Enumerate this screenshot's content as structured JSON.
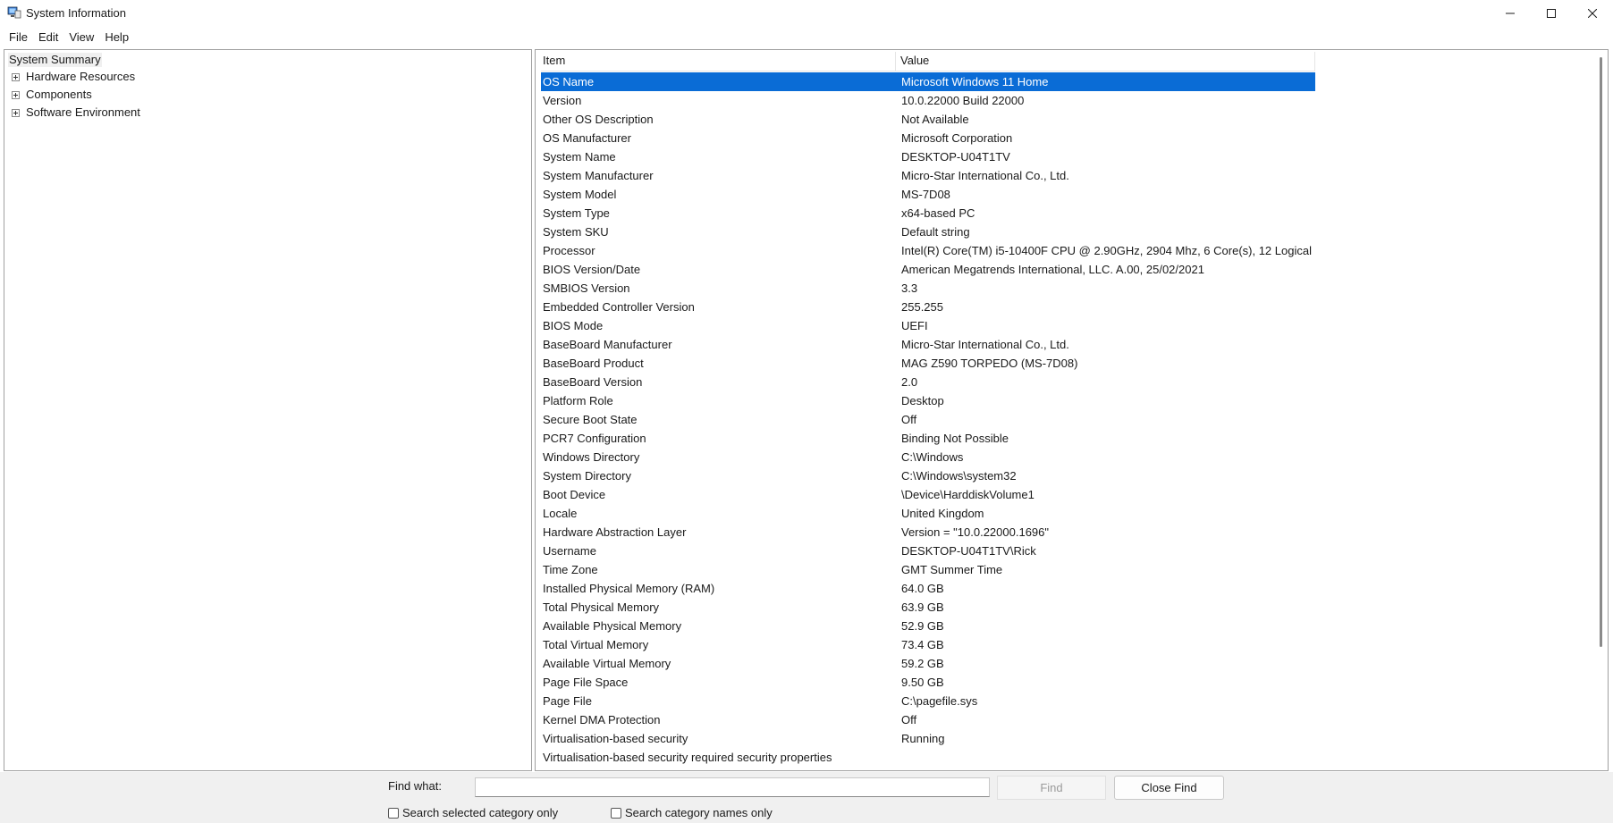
{
  "window": {
    "title": "System Information"
  },
  "menu": [
    "File",
    "Edit",
    "View",
    "Help"
  ],
  "tree": {
    "root": "System Summary",
    "children": [
      "Hardware Resources",
      "Components",
      "Software Environment"
    ]
  },
  "table": {
    "headers": {
      "item": "Item",
      "value": "Value"
    },
    "rows": [
      {
        "item": "OS Name",
        "value": "Microsoft Windows 11 Home",
        "selected": true
      },
      {
        "item": "Version",
        "value": "10.0.22000 Build 22000"
      },
      {
        "item": "Other OS Description",
        "value": "Not Available"
      },
      {
        "item": "OS Manufacturer",
        "value": "Microsoft Corporation"
      },
      {
        "item": "System Name",
        "value": "DESKTOP-U04T1TV"
      },
      {
        "item": "System Manufacturer",
        "value": "Micro-Star International Co., Ltd."
      },
      {
        "item": "System Model",
        "value": "MS-7D08"
      },
      {
        "item": "System Type",
        "value": "x64-based PC"
      },
      {
        "item": "System SKU",
        "value": "Default string"
      },
      {
        "item": "Processor",
        "value": "Intel(R) Core(TM) i5-10400F CPU @ 2.90GHz, 2904 Mhz, 6 Core(s), 12 Logical ..."
      },
      {
        "item": "BIOS Version/Date",
        "value": "American Megatrends International, LLC. A.00, 25/02/2021"
      },
      {
        "item": "SMBIOS Version",
        "value": "3.3"
      },
      {
        "item": "Embedded Controller Version",
        "value": "255.255"
      },
      {
        "item": "BIOS Mode",
        "value": "UEFI"
      },
      {
        "item": "BaseBoard Manufacturer",
        "value": "Micro-Star International Co., Ltd."
      },
      {
        "item": "BaseBoard Product",
        "value": "MAG Z590 TORPEDO (MS-7D08)"
      },
      {
        "item": "BaseBoard Version",
        "value": "2.0"
      },
      {
        "item": "Platform Role",
        "value": "Desktop"
      },
      {
        "item": "Secure Boot State",
        "value": "Off"
      },
      {
        "item": "PCR7 Configuration",
        "value": "Binding Not Possible"
      },
      {
        "item": "Windows Directory",
        "value": "C:\\Windows"
      },
      {
        "item": "System Directory",
        "value": "C:\\Windows\\system32"
      },
      {
        "item": "Boot Device",
        "value": "\\Device\\HarddiskVolume1"
      },
      {
        "item": "Locale",
        "value": "United Kingdom"
      },
      {
        "item": "Hardware Abstraction Layer",
        "value": "Version = \"10.0.22000.1696\""
      },
      {
        "item": "Username",
        "value": "DESKTOP-U04T1TV\\Rick"
      },
      {
        "item": "Time Zone",
        "value": "GMT Summer Time"
      },
      {
        "item": "Installed Physical Memory (RAM)",
        "value": "64.0 GB"
      },
      {
        "item": "Total Physical Memory",
        "value": "63.9 GB"
      },
      {
        "item": "Available Physical Memory",
        "value": "52.9 GB"
      },
      {
        "item": "Total Virtual Memory",
        "value": "73.4 GB"
      },
      {
        "item": "Available Virtual Memory",
        "value": "59.2 GB"
      },
      {
        "item": "Page File Space",
        "value": "9.50 GB"
      },
      {
        "item": "Page File",
        "value": "C:\\pagefile.sys"
      },
      {
        "item": "Kernel DMA Protection",
        "value": "Off"
      },
      {
        "item": "Virtualisation-based security",
        "value": "Running"
      },
      {
        "item": "Virtualisation-based security required security properties",
        "value": ""
      }
    ]
  },
  "find": {
    "label": "Find what:",
    "value": "",
    "find_button": "Find",
    "close_button": "Close Find",
    "option_selected_category": "Search selected category only",
    "option_category_names": "Search category names only"
  },
  "colors": {
    "selection": "#0a6cd6",
    "findbar_bg": "#f0f0f0"
  }
}
